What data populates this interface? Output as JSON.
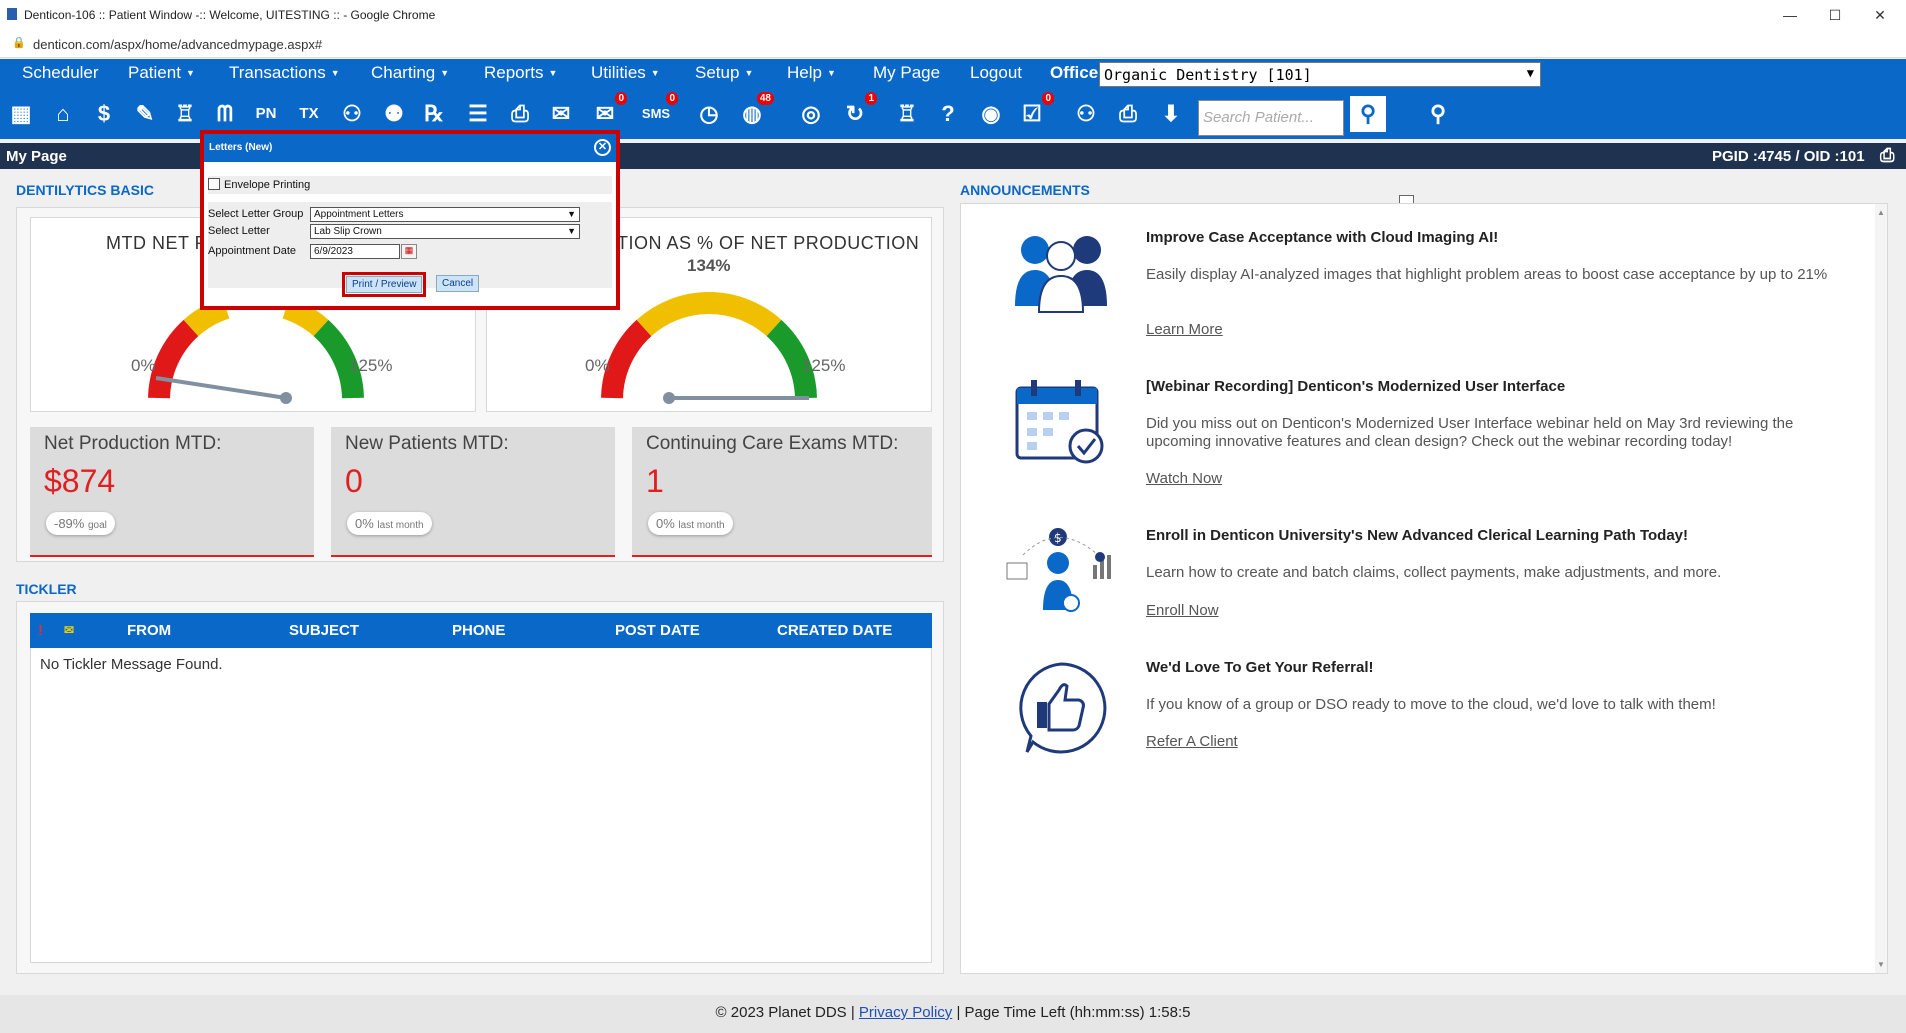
{
  "browser": {
    "title": "Denticon-106 :: Patient Window -:: Welcome, UITESTING :: - Google Chrome",
    "url": "denticon.com/aspx/home/advancedmypage.aspx#"
  },
  "menu": {
    "items": [
      "Scheduler",
      "Patient",
      "Transactions",
      "Charting",
      "Reports",
      "Utilities",
      "Setup",
      "Help",
      "My Page",
      "Logout"
    ],
    "office_label": "Office",
    "office_value": "Organic Dentistry [101]"
  },
  "toolbar": {
    "search_placeholder": "Search Patient...",
    "badges": {
      "mail": "0",
      "sms": "0",
      "globe": "48",
      "sync": "1",
      "rx": "0"
    }
  },
  "page": {
    "title": "My Page",
    "ids": "PGID :4745  /  OID :101"
  },
  "dentilytics": {
    "header": "DENTILYTICS BASIC",
    "gauge1": {
      "title": "MTD NET P",
      "min": "0%",
      "max": "125%"
    },
    "gauge2": {
      "title": "TION AS % OF NET PRODUCTION",
      "value": "134%",
      "min": "0%",
      "max": "125%"
    }
  },
  "cards": [
    {
      "label": "Net Production MTD:",
      "value": "$874",
      "pill": "-89%",
      "pill_sub": "goal"
    },
    {
      "label": "New Patients MTD:",
      "value": "0",
      "pill": "0%",
      "pill_sub": "last month"
    },
    {
      "label": "Continuing Care Exams MTD:",
      "value": "1",
      "pill": "0%",
      "pill_sub": "last month"
    }
  ],
  "tickler": {
    "header": "TICKLER",
    "columns": [
      "FROM",
      "SUBJECT",
      "PHONE",
      "POST DATE",
      "CREATED DATE"
    ],
    "empty": "No Tickler Message Found."
  },
  "announcements": {
    "header": "ANNOUNCEMENTS",
    "items": [
      {
        "title": "Improve Case Acceptance with Cloud Imaging AI!",
        "body": "Easily display AI-analyzed images that highlight problem areas to boost case acceptance by up to 21%",
        "link": "Learn More"
      },
      {
        "title": "[Webinar Recording] Denticon's Modernized User Interface",
        "body": "Did you miss out on Denticon's Modernized User Interface webinar held on May 3rd reviewing the upcoming innovative features and clean design? Check out the webinar recording today!",
        "link": "Watch Now"
      },
      {
        "title": "Enroll in Denticon University's New Advanced Clerical Learning Path Today!",
        "body": "Learn how to create and batch claims, collect payments, make adjustments, and more.",
        "link": "Enroll Now"
      },
      {
        "title": "We'd Love To Get Your Referral!",
        "body": "If you know of a group or DSO ready to move to the cloud, we'd love to talk with them!",
        "link": "Refer A Client"
      }
    ]
  },
  "dialog": {
    "title": "Letters (New)",
    "envelope": "Envelope Printing",
    "group_label": "Select Letter Group",
    "group_value": "Appointment Letters",
    "letter_label": "Select Letter",
    "letter_value": "Lab Slip Crown",
    "date_label": "Appointment Date",
    "date_value": "6/9/2023",
    "print": "Print / Preview",
    "cancel": "Cancel"
  },
  "footer": {
    "copyright": "© 2023 Planet DDS |",
    "privacy": "Privacy Policy",
    "time": "| Page Time Left (hh:mm:ss) 1:58:5"
  },
  "colors": {
    "primary": "#0a68c8",
    "header_dark": "#1f3250",
    "accent_red": "#e02020",
    "highlight": "#c00000"
  }
}
